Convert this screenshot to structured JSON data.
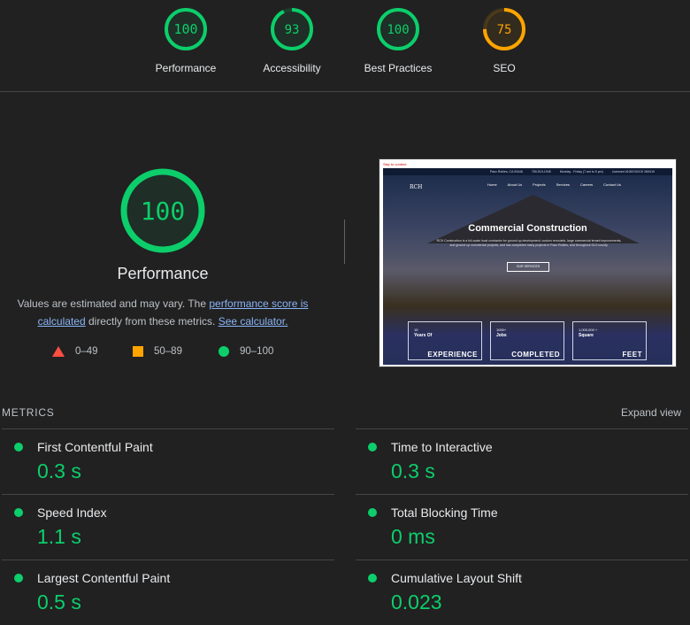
{
  "top_gauges": [
    {
      "score": "100",
      "label": "Performance",
      "value": 100,
      "color": "#0cce6b"
    },
    {
      "score": "93",
      "label": "Accessibility",
      "value": 93,
      "color": "#0cce6b"
    },
    {
      "score": "100",
      "label": "Best Practices",
      "value": 100,
      "color": "#0cce6b"
    },
    {
      "score": "75",
      "label": "SEO",
      "value": 75,
      "color": "#ffa400"
    }
  ],
  "performance": {
    "score": "100",
    "value": 100,
    "title": "Performance",
    "desc_prefix": "Values are estimated and may vary. The ",
    "desc_link1": "performance score is calculated",
    "desc_middle": " directly from these metrics. ",
    "desc_link2": "See calculator."
  },
  "legend": [
    {
      "range": "0–49",
      "icon": "triangle-icon",
      "color": "#ff4e42"
    },
    {
      "range": "50–89",
      "icon": "square-icon",
      "color": "#ffa400"
    },
    {
      "range": "90–100",
      "icon": "circle-icon",
      "color": "#0cce6b"
    }
  ],
  "thumbnail": {
    "skip_link": "Skip to content",
    "topbar": [
      "Paso Robles, CA 93446",
      "780-519-1945",
      "Monday - Friday (7 am to 5 pm)",
      "Licensed #1063 BOCK 069419"
    ],
    "logo": "RCH",
    "nav": [
      "Home",
      "About Us",
      "Projects",
      "Services",
      "Careers",
      "Contact Us"
    ],
    "hero_title": "Commercial Construction",
    "hero_sub": "RCH Construction is a full-scale local contractor for ground up development, custom remodels, large commercial tenant improvements, and ground up commercial projects, and has completed many projects in Paso Robles, and throughout SLO county.",
    "hero_button": "OUR SERVICES",
    "stats": [
      {
        "value": "15",
        "label": "Years Of",
        "big": "EXPERIENCE"
      },
      {
        "value": "1000+",
        "label": "Jobs",
        "big": "COMPLETED"
      },
      {
        "value": "1,000,000 +",
        "label": "Square",
        "big": "FEET"
      }
    ]
  },
  "metrics": {
    "heading": "METRICS",
    "expand": "Expand view",
    "items": [
      {
        "name": "First Contentful Paint",
        "value": "0.3 s"
      },
      {
        "name": "Time to Interactive",
        "value": "0.3 s"
      },
      {
        "name": "Speed Index",
        "value": "1.1 s"
      },
      {
        "name": "Total Blocking Time",
        "value": "0 ms"
      },
      {
        "name": "Largest Contentful Paint",
        "value": "0.5 s"
      },
      {
        "name": "Cumulative Layout Shift",
        "value": "0.023"
      }
    ]
  }
}
